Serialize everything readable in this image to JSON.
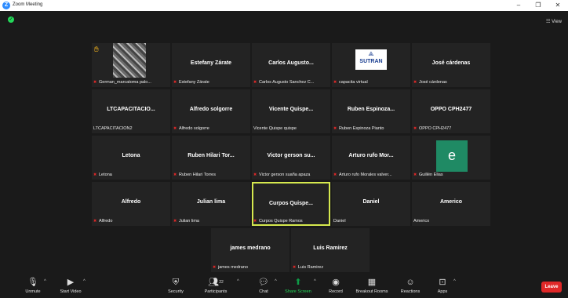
{
  "window": {
    "title": "Zoom Meeting",
    "controls": [
      "–",
      "❐",
      "✕"
    ]
  },
  "topbar": {
    "view_label": "☷ View"
  },
  "participants": [
    {
      "id": "german",
      "display": "",
      "label": "German_marcatoma palo...",
      "muted": true,
      "hand": true,
      "photo": true
    },
    {
      "id": "estefany",
      "display": "Estefany Zárate",
      "label": "Estefany Zárate",
      "muted": true
    },
    {
      "id": "carlos",
      "display": "Carlos Augusto...",
      "label": "Carlos Augusto Sanchez C...",
      "muted": true
    },
    {
      "id": "capacita",
      "display": "",
      "label": "capacita virtual",
      "muted": true,
      "logo": "SUTRAN"
    },
    {
      "id": "jose",
      "display": "José cárdenas",
      "label": "José cárdenas",
      "muted": true
    },
    {
      "id": "ltcap",
      "display": "LTCAPACITACIO...",
      "label": "LTCAPACITACION2",
      "muted": false
    },
    {
      "id": "alfredo_s",
      "display": "Alfredo solgorre",
      "label": "Alfredo solgorre",
      "muted": true
    },
    {
      "id": "vicente",
      "display": "Vicente Quispe...",
      "label": "Vicente Quispe quispe",
      "muted": false
    },
    {
      "id": "ruben_e",
      "display": "Ruben Espinoza...",
      "label": "Ruben Espinoza Pianto",
      "muted": true
    },
    {
      "id": "oppo",
      "display": "OPPO CPH2477",
      "label": "OPPO CPH2477",
      "muted": true
    },
    {
      "id": "letona",
      "display": "Letona",
      "label": "Letona",
      "muted": true
    },
    {
      "id": "ruben_h",
      "display": "Ruben Hilari Tor...",
      "label": "Ruben Hilari Torres",
      "muted": true
    },
    {
      "id": "victor",
      "display": "Victor gerson su...",
      "label": "Victor gerson suaña apaza",
      "muted": true
    },
    {
      "id": "arturo",
      "display": "Arturo rufo Mor...",
      "label": "Arturo rufo Morales valver...",
      "muted": true
    },
    {
      "id": "guillen",
      "display": "",
      "label": "Guillén Elias",
      "muted": true,
      "avatar": "e"
    },
    {
      "id": "alfredo",
      "display": "Alfredo",
      "label": "Alfredo",
      "muted": true
    },
    {
      "id": "julian",
      "display": "Julian lima",
      "label": "Julian lima",
      "muted": true
    },
    {
      "id": "curpos",
      "display": "Curpos Quispe...",
      "label": "Curpos Quispe Ramos",
      "muted": true,
      "active": true
    },
    {
      "id": "daniel",
      "display": "Daniel",
      "label": "Daniel",
      "muted": false
    },
    {
      "id": "americo",
      "display": "Americo",
      "label": "Americo",
      "muted": false
    },
    {
      "id": "james",
      "display": "james medrano",
      "label": "james medrano",
      "muted": true
    },
    {
      "id": "luis",
      "display": "Luis Ramirez",
      "label": "Luis Ramirez",
      "muted": true
    }
  ],
  "toolbar": {
    "unmute": "Unmute",
    "start_video": "Start Video",
    "security": "Security",
    "participants": "Participants",
    "participants_count": "22",
    "chat": "Chat",
    "share_screen": "Share Screen",
    "record": "Record",
    "breakout_rooms": "Breakout Rooms",
    "reactions": "Reactions",
    "apps": "Apps",
    "leave": "Leave"
  },
  "colors": {
    "active_speaker": "#d5e84e",
    "share_green": "#23d959",
    "leave_red": "#e02828",
    "avatar_green": "#1f8a64"
  }
}
